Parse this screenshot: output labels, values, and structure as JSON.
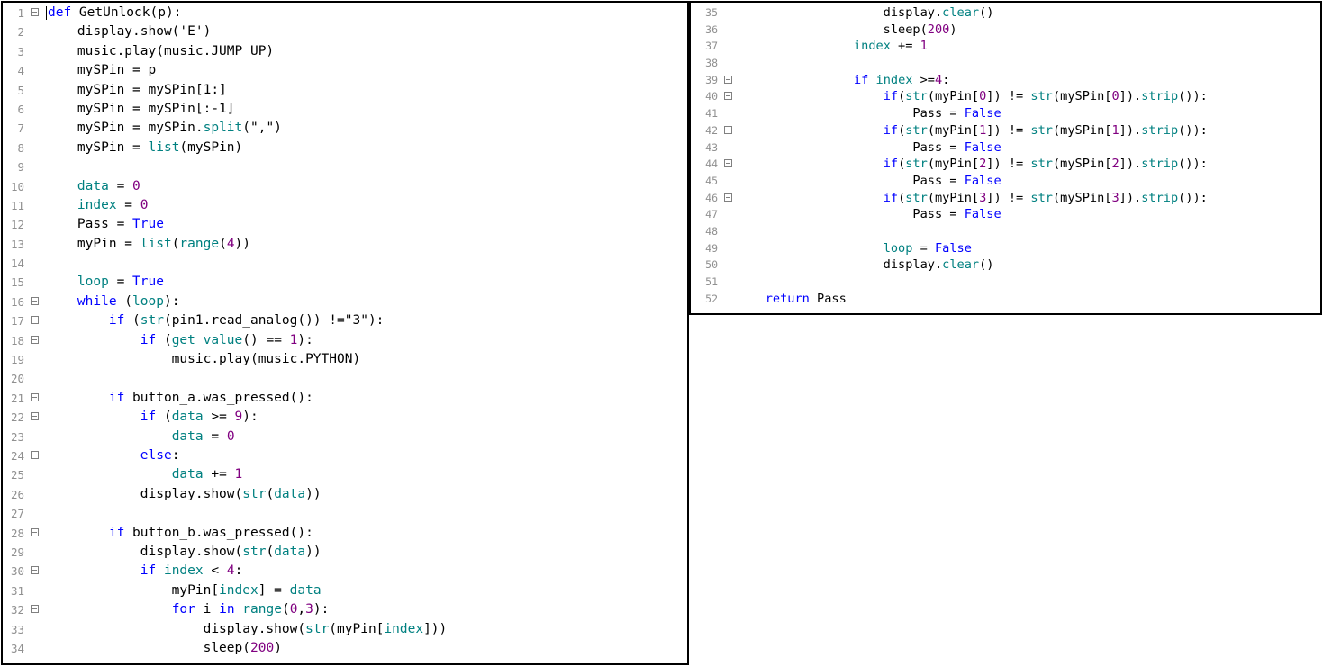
{
  "colors": {
    "keyword": "#0000ff",
    "builtin": "#008080",
    "number": "#800080",
    "line_number": "#909090",
    "text": "#000000"
  },
  "left_panel": {
    "lines": [
      {
        "n": "1",
        "fold": true,
        "tokens": [
          {
            "t": "def",
            "c": "kw"
          },
          {
            "t": " GetUnlock(p):"
          }
        ]
      },
      {
        "n": "2",
        "fold": false,
        "tokens": [
          {
            "t": "    display.show('E')"
          }
        ]
      },
      {
        "n": "3",
        "fold": false,
        "tokens": [
          {
            "t": "    music.play(music.JUMP_UP)"
          }
        ]
      },
      {
        "n": "4",
        "fold": false,
        "tokens": [
          {
            "t": "    mySPin = p"
          }
        ]
      },
      {
        "n": "5",
        "fold": false,
        "tokens": [
          {
            "t": "    mySPin = mySPin[1:]"
          }
        ]
      },
      {
        "n": "6",
        "fold": false,
        "tokens": [
          {
            "t": "    mySPin = mySPin[:-1]"
          }
        ]
      },
      {
        "n": "7",
        "fold": false,
        "tokens": [
          {
            "t": "    mySPin = mySPin."
          },
          {
            "t": "split",
            "c": "fn"
          },
          {
            "t": "(\",\")"
          }
        ]
      },
      {
        "n": "8",
        "fold": false,
        "tokens": [
          {
            "t": "    mySPin = "
          },
          {
            "t": "list",
            "c": "fn"
          },
          {
            "t": "(mySPin)"
          }
        ]
      },
      {
        "n": "9",
        "fold": false,
        "tokens": []
      },
      {
        "n": "10",
        "fold": false,
        "tokens": [
          {
            "t": "    "
          },
          {
            "t": "data",
            "c": "fn"
          },
          {
            "t": " = "
          },
          {
            "t": "0",
            "c": "num"
          }
        ]
      },
      {
        "n": "11",
        "fold": false,
        "tokens": [
          {
            "t": "    "
          },
          {
            "t": "index",
            "c": "fn"
          },
          {
            "t": " = "
          },
          {
            "t": "0",
            "c": "num"
          }
        ]
      },
      {
        "n": "12",
        "fold": false,
        "tokens": [
          {
            "t": "    Pass = "
          },
          {
            "t": "True",
            "c": "kw"
          }
        ]
      },
      {
        "n": "13",
        "fold": false,
        "tokens": [
          {
            "t": "    myPin = "
          },
          {
            "t": "list",
            "c": "fn"
          },
          {
            "t": "("
          },
          {
            "t": "range",
            "c": "fn"
          },
          {
            "t": "("
          },
          {
            "t": "4",
            "c": "num"
          },
          {
            "t": "))"
          }
        ]
      },
      {
        "n": "14",
        "fold": false,
        "tokens": []
      },
      {
        "n": "15",
        "fold": false,
        "tokens": [
          {
            "t": "    "
          },
          {
            "t": "loop",
            "c": "fn"
          },
          {
            "t": " = "
          },
          {
            "t": "True",
            "c": "kw"
          }
        ]
      },
      {
        "n": "16",
        "fold": true,
        "tokens": [
          {
            "t": "    "
          },
          {
            "t": "while",
            "c": "kw"
          },
          {
            "t": " ("
          },
          {
            "t": "loop",
            "c": "fn"
          },
          {
            "t": "):"
          }
        ]
      },
      {
        "n": "17",
        "fold": true,
        "tokens": [
          {
            "t": "        "
          },
          {
            "t": "if",
            "c": "kw"
          },
          {
            "t": " ("
          },
          {
            "t": "str",
            "c": "fn"
          },
          {
            "t": "(pin1.read_analog()) !=\"3\"):"
          }
        ]
      },
      {
        "n": "18",
        "fold": true,
        "tokens": [
          {
            "t": "            "
          },
          {
            "t": "if",
            "c": "kw"
          },
          {
            "t": " ("
          },
          {
            "t": "get_value",
            "c": "fn"
          },
          {
            "t": "() == "
          },
          {
            "t": "1",
            "c": "num"
          },
          {
            "t": "):"
          }
        ]
      },
      {
        "n": "19",
        "fold": false,
        "tokens": [
          {
            "t": "                music.play(music.PYTHON)"
          }
        ]
      },
      {
        "n": "20",
        "fold": false,
        "tokens": []
      },
      {
        "n": "21",
        "fold": true,
        "tokens": [
          {
            "t": "        "
          },
          {
            "t": "if",
            "c": "kw"
          },
          {
            "t": " button_a.was_pressed():"
          }
        ]
      },
      {
        "n": "22",
        "fold": true,
        "tokens": [
          {
            "t": "            "
          },
          {
            "t": "if",
            "c": "kw"
          },
          {
            "t": " ("
          },
          {
            "t": "data",
            "c": "fn"
          },
          {
            "t": " >= "
          },
          {
            "t": "9",
            "c": "num"
          },
          {
            "t": "):"
          }
        ]
      },
      {
        "n": "23",
        "fold": false,
        "tokens": [
          {
            "t": "                "
          },
          {
            "t": "data",
            "c": "fn"
          },
          {
            "t": " = "
          },
          {
            "t": "0",
            "c": "num"
          }
        ]
      },
      {
        "n": "24",
        "fold": true,
        "tokens": [
          {
            "t": "            "
          },
          {
            "t": "else",
            "c": "kw"
          },
          {
            "t": ":"
          }
        ]
      },
      {
        "n": "25",
        "fold": false,
        "tokens": [
          {
            "t": "                "
          },
          {
            "t": "data",
            "c": "fn"
          },
          {
            "t": " += "
          },
          {
            "t": "1",
            "c": "num"
          }
        ]
      },
      {
        "n": "26",
        "fold": false,
        "tokens": [
          {
            "t": "            display.show("
          },
          {
            "t": "str",
            "c": "fn"
          },
          {
            "t": "("
          },
          {
            "t": "data",
            "c": "fn"
          },
          {
            "t": "))"
          }
        ]
      },
      {
        "n": "27",
        "fold": false,
        "tokens": []
      },
      {
        "n": "28",
        "fold": true,
        "tokens": [
          {
            "t": "        "
          },
          {
            "t": "if",
            "c": "kw"
          },
          {
            "t": " button_b.was_pressed():"
          }
        ]
      },
      {
        "n": "29",
        "fold": false,
        "tokens": [
          {
            "t": "            display.show("
          },
          {
            "t": "str",
            "c": "fn"
          },
          {
            "t": "("
          },
          {
            "t": "data",
            "c": "fn"
          },
          {
            "t": "))"
          }
        ]
      },
      {
        "n": "30",
        "fold": true,
        "tokens": [
          {
            "t": "            "
          },
          {
            "t": "if",
            "c": "kw"
          },
          {
            "t": " "
          },
          {
            "t": "index",
            "c": "fn"
          },
          {
            "t": " < "
          },
          {
            "t": "4",
            "c": "num"
          },
          {
            "t": ":"
          }
        ]
      },
      {
        "n": "31",
        "fold": false,
        "tokens": [
          {
            "t": "                myPin["
          },
          {
            "t": "index",
            "c": "fn"
          },
          {
            "t": "] = "
          },
          {
            "t": "data",
            "c": "fn"
          }
        ]
      },
      {
        "n": "32",
        "fold": true,
        "tokens": [
          {
            "t": "                "
          },
          {
            "t": "for",
            "c": "kw"
          },
          {
            "t": " i "
          },
          {
            "t": "in",
            "c": "kw"
          },
          {
            "t": " "
          },
          {
            "t": "range",
            "c": "fn"
          },
          {
            "t": "("
          },
          {
            "t": "0",
            "c": "num"
          },
          {
            "t": ","
          },
          {
            "t": "3",
            "c": "num"
          },
          {
            "t": "):"
          }
        ]
      },
      {
        "n": "33",
        "fold": false,
        "tokens": [
          {
            "t": "                    display.show("
          },
          {
            "t": "str",
            "c": "fn"
          },
          {
            "t": "(myPin["
          },
          {
            "t": "index",
            "c": "fn"
          },
          {
            "t": "]))"
          }
        ]
      },
      {
        "n": "34",
        "fold": false,
        "tokens": [
          {
            "t": "                    sleep("
          },
          {
            "t": "200",
            "c": "num"
          },
          {
            "t": ")"
          }
        ]
      }
    ]
  },
  "right_panel": {
    "lines": [
      {
        "n": "35",
        "fold": false,
        "tokens": [
          {
            "t": "                    display."
          },
          {
            "t": "clear",
            "c": "fn"
          },
          {
            "t": "()"
          }
        ]
      },
      {
        "n": "36",
        "fold": false,
        "tokens": [
          {
            "t": "                    sleep("
          },
          {
            "t": "200",
            "c": "num"
          },
          {
            "t": ")"
          }
        ]
      },
      {
        "n": "37",
        "fold": false,
        "tokens": [
          {
            "t": "                "
          },
          {
            "t": "index",
            "c": "fn"
          },
          {
            "t": " += "
          },
          {
            "t": "1",
            "c": "num"
          }
        ]
      },
      {
        "n": "38",
        "fold": false,
        "tokens": []
      },
      {
        "n": "39",
        "fold": true,
        "tokens": [
          {
            "t": "                "
          },
          {
            "t": "if",
            "c": "kw"
          },
          {
            "t": " "
          },
          {
            "t": "index",
            "c": "fn"
          },
          {
            "t": " >="
          },
          {
            "t": "4",
            "c": "num"
          },
          {
            "t": ":"
          }
        ]
      },
      {
        "n": "40",
        "fold": true,
        "tokens": [
          {
            "t": "                    "
          },
          {
            "t": "if",
            "c": "kw"
          },
          {
            "t": "("
          },
          {
            "t": "str",
            "c": "fn"
          },
          {
            "t": "(myPin["
          },
          {
            "t": "0",
            "c": "num"
          },
          {
            "t": "]) != "
          },
          {
            "t": "str",
            "c": "fn"
          },
          {
            "t": "(mySPin["
          },
          {
            "t": "0",
            "c": "num"
          },
          {
            "t": "])."
          },
          {
            "t": "strip",
            "c": "fn"
          },
          {
            "t": "()):"
          }
        ]
      },
      {
        "n": "41",
        "fold": false,
        "tokens": [
          {
            "t": "                        Pass = "
          },
          {
            "t": "False",
            "c": "kw"
          }
        ]
      },
      {
        "n": "42",
        "fold": true,
        "tokens": [
          {
            "t": "                    "
          },
          {
            "t": "if",
            "c": "kw"
          },
          {
            "t": "("
          },
          {
            "t": "str",
            "c": "fn"
          },
          {
            "t": "(myPin["
          },
          {
            "t": "1",
            "c": "num"
          },
          {
            "t": "]) != "
          },
          {
            "t": "str",
            "c": "fn"
          },
          {
            "t": "(mySPin["
          },
          {
            "t": "1",
            "c": "num"
          },
          {
            "t": "])."
          },
          {
            "t": "strip",
            "c": "fn"
          },
          {
            "t": "()):"
          }
        ]
      },
      {
        "n": "43",
        "fold": false,
        "tokens": [
          {
            "t": "                        Pass = "
          },
          {
            "t": "False",
            "c": "kw"
          }
        ]
      },
      {
        "n": "44",
        "fold": true,
        "tokens": [
          {
            "t": "                    "
          },
          {
            "t": "if",
            "c": "kw"
          },
          {
            "t": "("
          },
          {
            "t": "str",
            "c": "fn"
          },
          {
            "t": "(myPin["
          },
          {
            "t": "2",
            "c": "num"
          },
          {
            "t": "]) != "
          },
          {
            "t": "str",
            "c": "fn"
          },
          {
            "t": "(mySPin["
          },
          {
            "t": "2",
            "c": "num"
          },
          {
            "t": "])."
          },
          {
            "t": "strip",
            "c": "fn"
          },
          {
            "t": "()):"
          }
        ]
      },
      {
        "n": "45",
        "fold": false,
        "tokens": [
          {
            "t": "                        Pass = "
          },
          {
            "t": "False",
            "c": "kw"
          }
        ]
      },
      {
        "n": "46",
        "fold": true,
        "tokens": [
          {
            "t": "                    "
          },
          {
            "t": "if",
            "c": "kw"
          },
          {
            "t": "("
          },
          {
            "t": "str",
            "c": "fn"
          },
          {
            "t": "(myPin["
          },
          {
            "t": "3",
            "c": "num"
          },
          {
            "t": "]) != "
          },
          {
            "t": "str",
            "c": "fn"
          },
          {
            "t": "(mySPin["
          },
          {
            "t": "3",
            "c": "num"
          },
          {
            "t": "])."
          },
          {
            "t": "strip",
            "c": "fn"
          },
          {
            "t": "()):"
          }
        ]
      },
      {
        "n": "47",
        "fold": false,
        "tokens": [
          {
            "t": "                        Pass = "
          },
          {
            "t": "False",
            "c": "kw"
          }
        ]
      },
      {
        "n": "48",
        "fold": false,
        "tokens": []
      },
      {
        "n": "49",
        "fold": false,
        "tokens": [
          {
            "t": "                    "
          },
          {
            "t": "loop",
            "c": "fn"
          },
          {
            "t": " = "
          },
          {
            "t": "False",
            "c": "kw"
          }
        ]
      },
      {
        "n": "50",
        "fold": false,
        "tokens": [
          {
            "t": "                    display."
          },
          {
            "t": "clear",
            "c": "fn"
          },
          {
            "t": "()"
          }
        ]
      },
      {
        "n": "51",
        "fold": false,
        "tokens": []
      },
      {
        "n": "52",
        "fold": false,
        "tokens": [
          {
            "t": "    "
          },
          {
            "t": "return",
            "c": "kw"
          },
          {
            "t": " Pass"
          }
        ]
      }
    ]
  }
}
